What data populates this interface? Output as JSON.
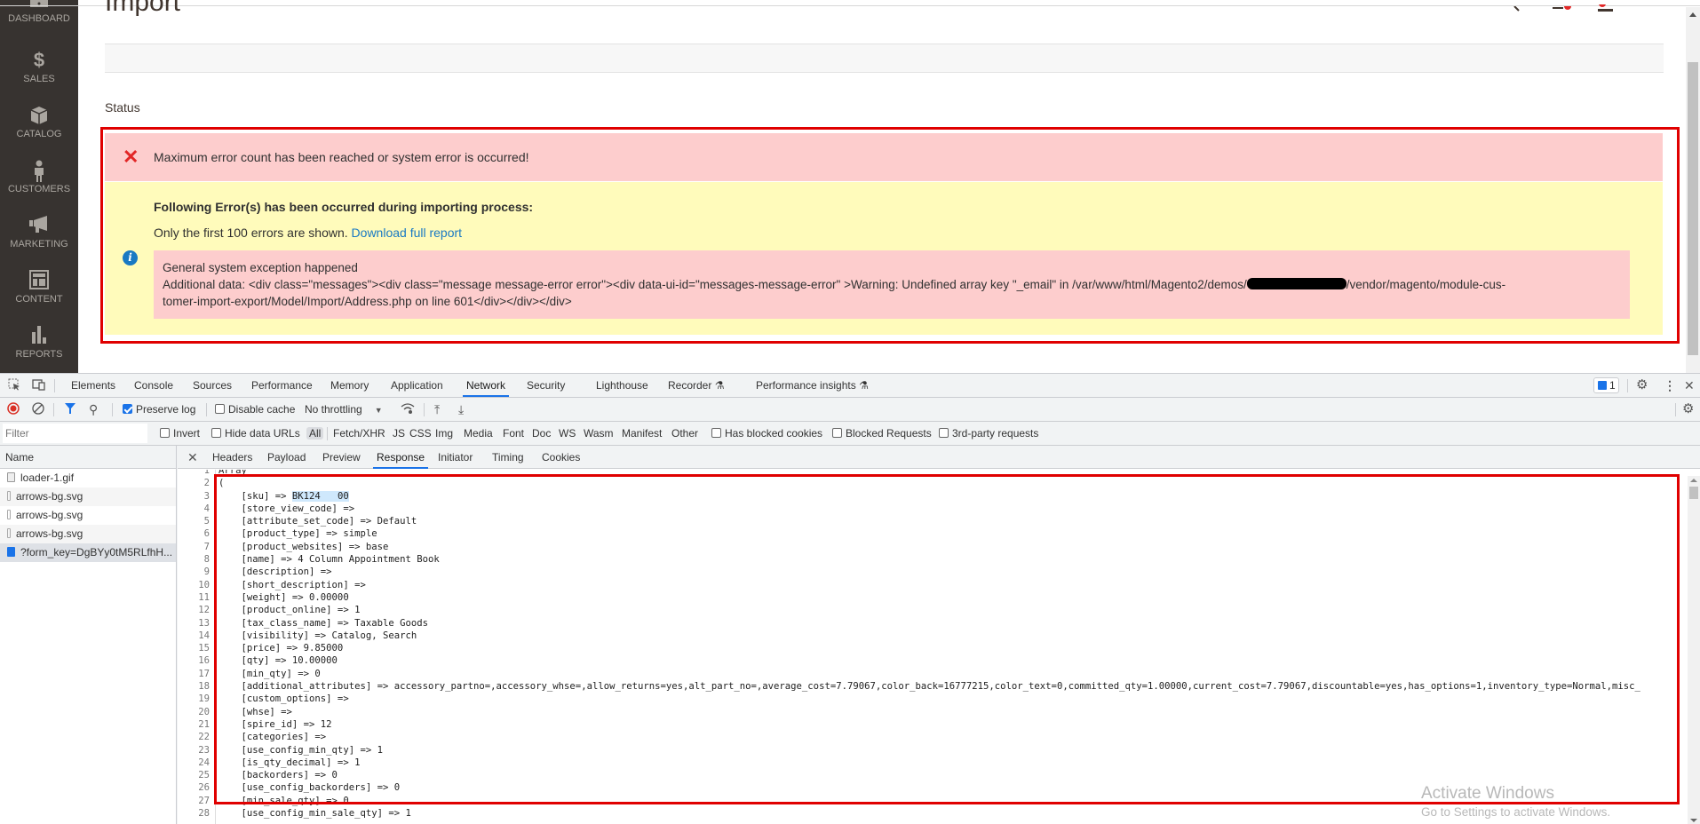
{
  "page": {
    "title": "Import",
    "status_label": "Status",
    "sidebar": [
      {
        "label": "DASHBOARD",
        "icon": "dashboard-icon"
      },
      {
        "label": "SALES",
        "icon": "dollar-icon"
      },
      {
        "label": "CATALOG",
        "icon": "box-icon"
      },
      {
        "label": "CUSTOMERS",
        "icon": "person-icon"
      },
      {
        "label": "MARKETING",
        "icon": "megaphone-icon"
      },
      {
        "label": "CONTENT",
        "icon": "layout-icon"
      },
      {
        "label": "REPORTS",
        "icon": "bar-chart-icon"
      }
    ],
    "error_message": "Maximum error count has been reached or system error is occurred!",
    "warning": {
      "title": "Following Error(s) has been occurred during importing process:",
      "subtitle": "Only the first 100 errors are shown.",
      "download_link": "Download full report",
      "exception_title": "General system exception happened",
      "exception_line1_a": "Additional data: <div class=\"messages\"><div class=\"message message-error error\"><div data-ui-id=\"messages-message-error\" >Warning: Undefined array key \"_email\" in /var/www/html/Magento2/demos/",
      "exception_line1_b": "/vendor/magento/module-cus-",
      "exception_line2": "tomer-import-export/Model/Import/Address.php on line 601</div></div></div>"
    },
    "accent_colors": {
      "error_bg": "#fdcdcd",
      "warning_bg": "#fffbbb",
      "link": "#1979c3",
      "annotation": "#e00000",
      "sidebar_bg": "#373330"
    }
  },
  "devtools": {
    "main_tabs": [
      "Elements",
      "Console",
      "Sources",
      "Performance",
      "Memory",
      "Application",
      "Network",
      "Security",
      "Lighthouse",
      "Recorder",
      "Performance insights"
    ],
    "active_tab": "Network",
    "issues_count": "1",
    "toolbar": {
      "preserve_log": "Preserve log",
      "preserve_log_checked": true,
      "disable_cache": "Disable cache",
      "disable_cache_checked": false,
      "throttling": "No throttling"
    },
    "filter": {
      "placeholder": "Filter",
      "invert": "Invert",
      "hide_data_urls": "Hide data URLs",
      "types": [
        "All",
        "Fetch/XHR",
        "JS",
        "CSS",
        "Img",
        "Media",
        "Font",
        "Doc",
        "WS",
        "Wasm",
        "Manifest",
        "Other"
      ],
      "active_type": "All",
      "has_blocked_cookies": "Has blocked cookies",
      "blocked_requests": "Blocked Requests",
      "third_party": "3rd-party requests"
    },
    "requests": {
      "header": "Name",
      "items": [
        {
          "name": "loader-1.gif",
          "type": "gif"
        },
        {
          "name": "arrows-bg.svg",
          "type": "svg"
        },
        {
          "name": "arrows-bg.svg",
          "type": "svg"
        },
        {
          "name": "arrows-bg.svg",
          "type": "svg"
        },
        {
          "name": "?form_key=DgBYy0tM5RLfhH...",
          "type": "doc",
          "selected": true
        }
      ]
    },
    "detail_tabs": [
      "Headers",
      "Payload",
      "Preview",
      "Response",
      "Initiator",
      "Timing",
      "Cookies"
    ],
    "active_detail_tab": "Response",
    "response_lines": [
      "Array",
      "(",
      "    [sku] => BK124   00",
      "    [store_view_code] =>",
      "    [attribute_set_code] => Default",
      "    [product_type] => simple",
      "    [product_websites] => base",
      "    [name] => 4 Column Appointment Book",
      "    [description] =>",
      "    [short_description] =>",
      "    [weight] => 0.00000",
      "    [product_online] => 1",
      "    [tax_class_name] => Taxable Goods",
      "    [visibility] => Catalog, Search",
      "    [price] => 9.85000",
      "    [qty] => 10.00000",
      "    [min_qty] => 0",
      "    [additional_attributes] => accessory_partno=,accessory_whse=,allow_returns=yes,alt_part_no=,average_cost=7.79067,color_back=16777215,color_text=0,committed_qty=1.00000,current_cost=7.79067,discountable=yes,has_options=1,inventory_type=Normal,misc_",
      "    [custom_options] =>",
      "    [whse] =>",
      "    [spire_id] => 12",
      "    [categories] =>",
      "    [use_config_min_qty] => 1",
      "    [is_qty_decimal] => 1",
      "    [backorders] => 0",
      "    [use_config_backorders] => 0",
      "    [min_sale_qty] => 0",
      "    [use_config_min_sale_qty] => 1"
    ]
  },
  "watermark": {
    "line1": "Activate Windows",
    "line2": "Go to Settings to activate Windows."
  }
}
